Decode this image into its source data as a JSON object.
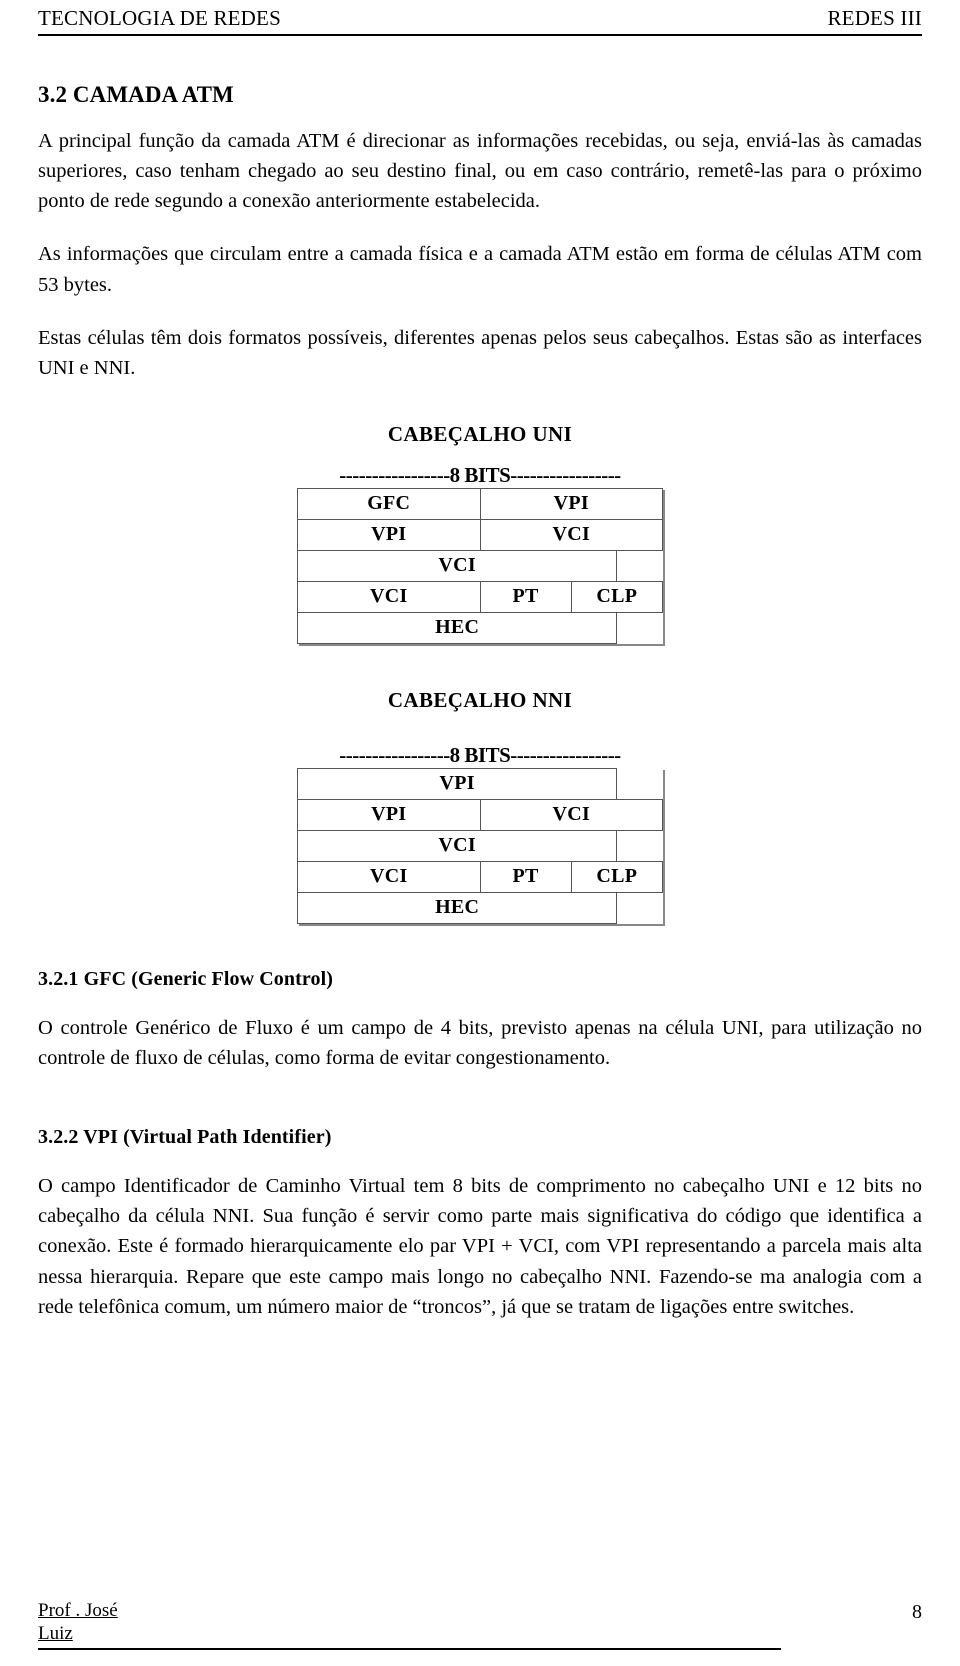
{
  "header": {
    "left": "TECNOLOGIA DE REDES",
    "right": "REDES III"
  },
  "section": {
    "number_title": "3.2 CAMADA ATM",
    "paragraphs": [
      "A principal função da camada ATM é direcionar as informações recebidas, ou seja, enviá-las às camadas superiores, caso tenham chegado ao seu destino final, ou em caso contrário, remetê-las para o próximo ponto de rede segundo a conexão anteriormente estabelecida.",
      "As informações que circulam entre a camada física e a camada ATM estão em forma de células ATM com 53 bytes.",
      "Estas células têm dois formatos possíveis, diferentes apenas pelos seus cabeçalhos. Estas são as interfaces UNI e NNI."
    ]
  },
  "diagrams": [
    {
      "title": "CABEÇALHO UNI",
      "ruler": "-----------------8 BITS-----------------",
      "rows": [
        [
          {
            "label": "GFC",
            "span": 4
          },
          {
            "label": "VPI",
            "span": 4
          }
        ],
        [
          {
            "label": "VPI",
            "span": 4
          },
          {
            "label": "VCI",
            "span": 4
          }
        ],
        [
          {
            "label": "VCI",
            "span": 7
          },
          {
            "label": "",
            "span": 1
          }
        ],
        [
          {
            "label": "VCI",
            "span": 4
          },
          {
            "label": "PT",
            "span": 2
          },
          {
            "label": "CLP",
            "span": 2
          }
        ],
        [
          {
            "label": "HEC",
            "span": 7
          },
          {
            "label": "",
            "span": 1
          }
        ]
      ]
    },
    {
      "title": "CABEÇALHO NNI",
      "ruler": "-----------------8 BITS-----------------",
      "rows": [
        [
          {
            "label": "VPI",
            "span": 7
          },
          {
            "label": "",
            "span": 1
          }
        ],
        [
          {
            "label": "VPI",
            "span": 4
          },
          {
            "label": "VCI",
            "span": 4
          }
        ],
        [
          {
            "label": "VCI",
            "span": 7
          },
          {
            "label": "",
            "span": 1
          }
        ],
        [
          {
            "label": "VCI",
            "span": 4
          },
          {
            "label": "PT",
            "span": 2
          },
          {
            "label": "CLP",
            "span": 2
          }
        ],
        [
          {
            "label": "HEC",
            "span": 7
          },
          {
            "label": "",
            "span": 1
          }
        ]
      ]
    }
  ],
  "subsections": [
    {
      "title": "3.2.1 GFC (Generic Flow Control)",
      "paragraph": "O controle Genérico de Fluxo é um campo de 4 bits, previsto apenas na célula UNI, para utilização no controle de fluxo de células, como   forma de evitar congestionamento."
    },
    {
      "title": "3.2.2 VPI (Virtual Path Identifier)",
      "paragraph": "O campo Identificador de Caminho Virtual tem 8 bits de comprimento no cabeçalho UNI e 12 bits no cabeçalho da célula NNI. Sua função é servir como parte mais significativa do código que identifica a conexão. Este é formado hierarquicamente elo par VPI + VCI, com VPI representando a parcela mais alta nessa hierarquia. Repare que este campo mais longo no cabeçalho NNI. Fazendo-se ma analogia com a rede telefônica comum, um número maior de “troncos”, já que se tratam de ligações entre switches."
    }
  ],
  "footer": {
    "author_line1": "Prof . José",
    "author_line2": "Luiz",
    "page_number": "8"
  }
}
